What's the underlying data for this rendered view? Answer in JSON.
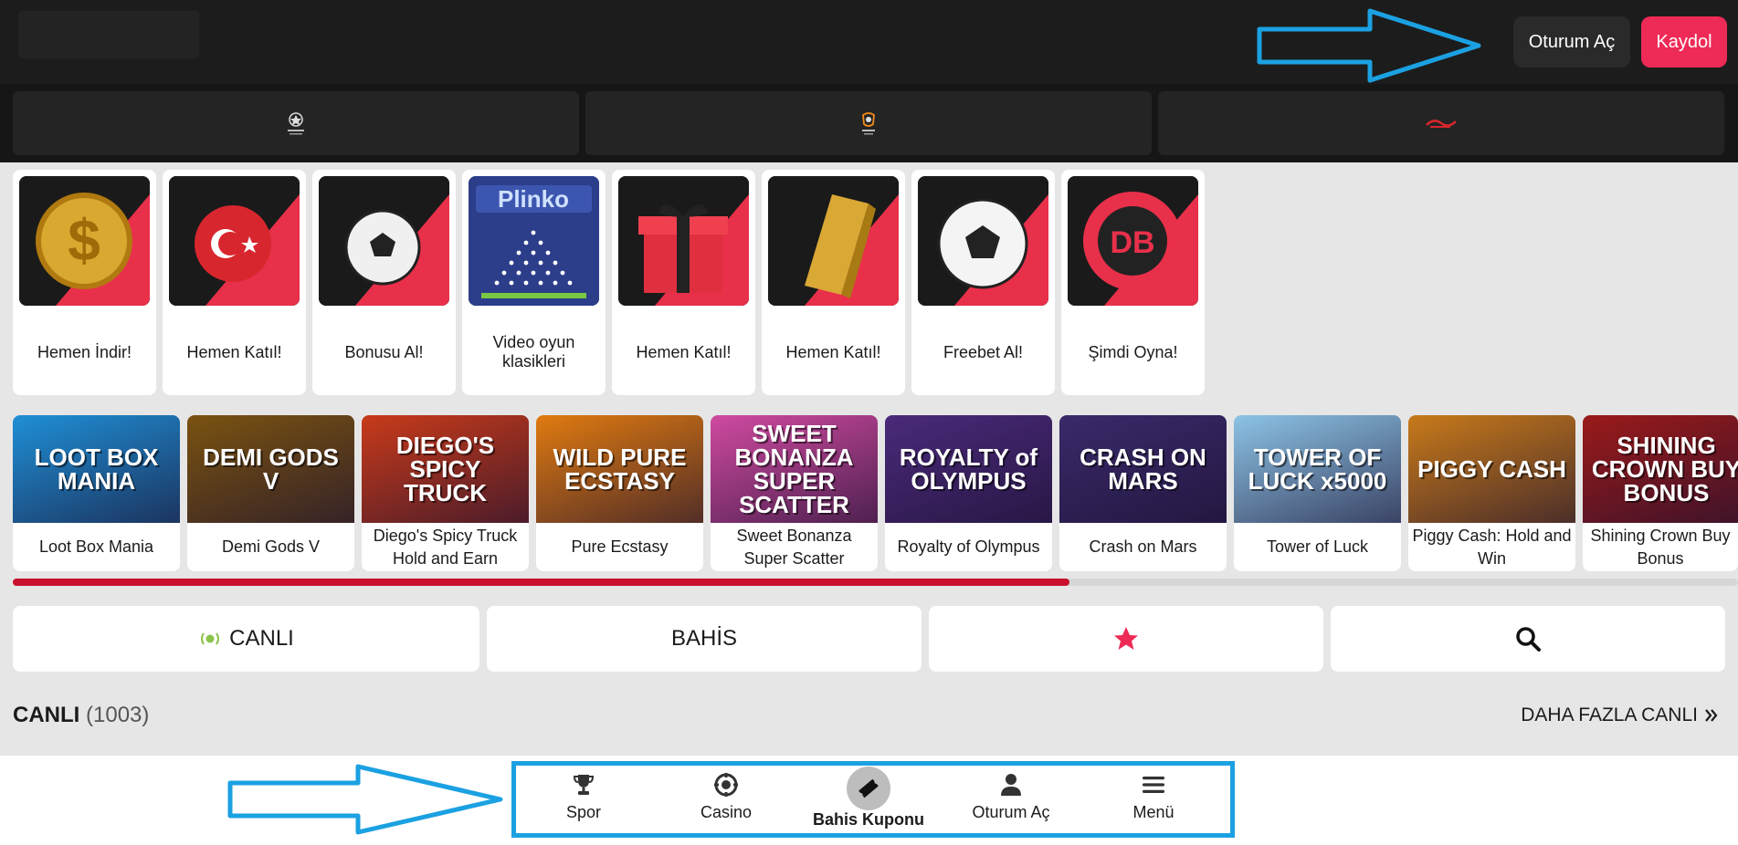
{
  "header": {
    "login_label": "Oturum Aç",
    "register_label": "Kaydol"
  },
  "leagues": [
    {
      "name": "champions-league-logo"
    },
    {
      "name": "europa-league-logo"
    },
    {
      "name": "super-lig-logo"
    }
  ],
  "promos": [
    {
      "label": "Hemen İndir!",
      "icon": "gold-coin-icon"
    },
    {
      "label": "Hemen Katıl!",
      "icon": "turkey-ball-net-icon"
    },
    {
      "label": "Bonusu Al!",
      "icon": "football-net-icon"
    },
    {
      "label": "Video oyun klasikleri",
      "icon": "plinko-icon",
      "img_text": "Plinko"
    },
    {
      "label": "Hemen Katıl!",
      "icon": "gift-box-icon"
    },
    {
      "label": "Hemen Katıl!",
      "icon": "gold-bar-icon"
    },
    {
      "label": "Freebet Al!",
      "icon": "football-icon"
    },
    {
      "label": "Şimdi Oyna!",
      "icon": "casino-chip-icon",
      "img_text": "DB"
    }
  ],
  "games": [
    {
      "label": "Loot Box Mania",
      "img_text": "LOOT BOX MANIA",
      "color": "#1f8fd6"
    },
    {
      "label": "Demi Gods V",
      "img_text": "DEMI GODS V",
      "color": "#7a5210"
    },
    {
      "label": "Diego's Spicy Truck Hold and Earn",
      "img_text": "DIEGO'S SPICY TRUCK",
      "color": "#c83a1a"
    },
    {
      "label": "Pure Ecstasy",
      "img_text": "WILD PURE ECSTASY",
      "color": "#e07a10"
    },
    {
      "label": "Sweet Bonanza Super Scatter",
      "img_text": "SWEET BONANZA SUPER SCATTER",
      "color": "#d04aa0"
    },
    {
      "label": "Royalty of Olympus",
      "img_text": "ROYALTY of OLYMPUS",
      "color": "#4a2a7a"
    },
    {
      "label": "Crash on Mars",
      "img_text": "CRASH ON MARS",
      "color": "#3a2a6a"
    },
    {
      "label": "Tower of Luck",
      "img_text": "TOWER OF LUCK x5000",
      "color": "#8cc3e6"
    },
    {
      "label": "Piggy Cash: Hold and Win",
      "img_text": "PIGGY CASH",
      "color": "#c87a1a"
    },
    {
      "label": "Shining Crown Buy Bonus",
      "img_text": "SHINING CROWN BUY BONUS",
      "color": "#9a1a1a"
    }
  ],
  "filters": {
    "live_label": "CANLI",
    "bet_label": "BAHİS"
  },
  "section": {
    "title": "CANLI",
    "count": "(1003)",
    "more_label": "DAHA FAZLA CANLI"
  },
  "nav": [
    {
      "label": "Spor",
      "icon": "trophy-icon"
    },
    {
      "label": "Casino",
      "icon": "casino-chip-icon"
    },
    {
      "label": "Bahis Kuponu",
      "icon": "ticket-icon"
    },
    {
      "label": "Oturum Aç",
      "icon": "user-icon"
    },
    {
      "label": "Menü",
      "icon": "menu-icon"
    }
  ],
  "colors": {
    "accent": "#ee2a56",
    "header_bg": "#1c1c1c",
    "live_green": "#8ac34a",
    "annotation_blue": "#1ba1e2"
  }
}
